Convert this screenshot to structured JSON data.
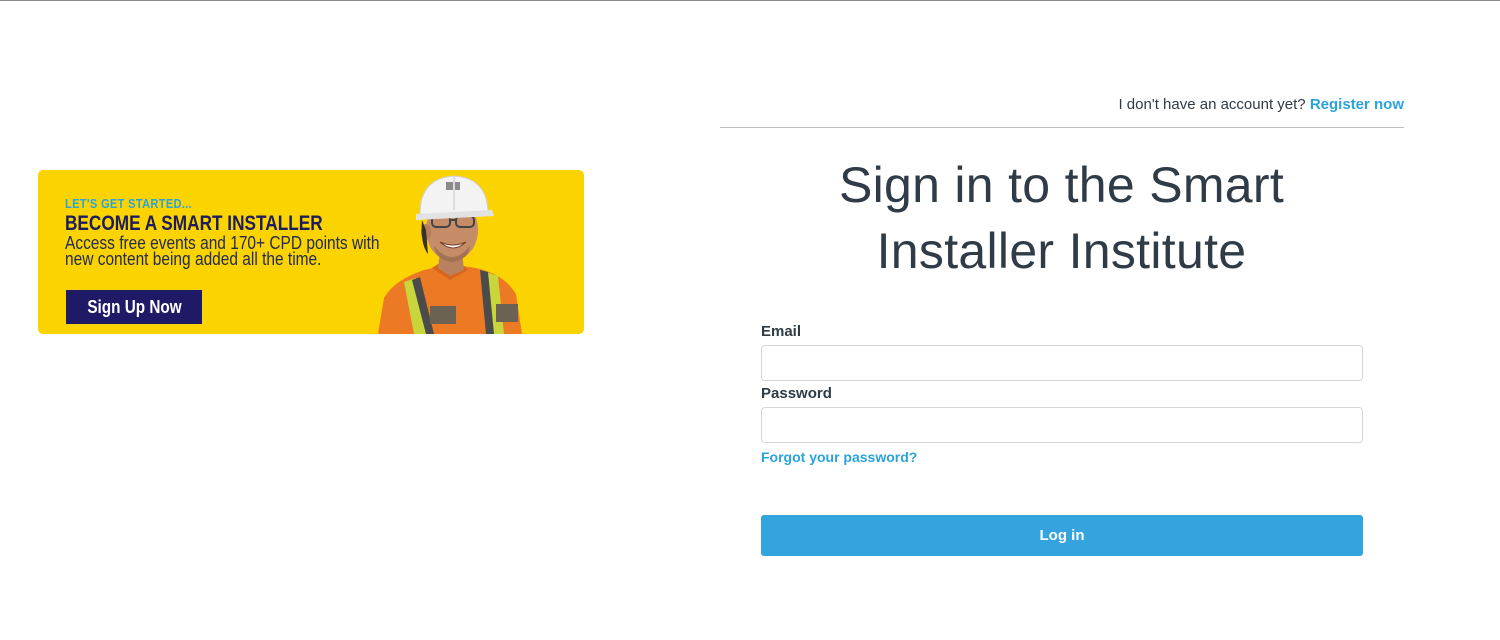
{
  "banner": {
    "eyebrow": "LET'S GET STARTED...",
    "headline": "BECOME A SMART INSTALLER",
    "description": "Access free events and 170+ CPD points with new content being added all the time.",
    "cta_label": "Sign Up Now",
    "background_color": "#fbd400",
    "cta_color": "#1f1a66"
  },
  "auth": {
    "account_prompt": "I don't have an account yet?",
    "register_label": "Register now",
    "title": "Sign in to the Smart Installer Institute",
    "email_label": "Email",
    "email_value": "",
    "password_label": "Password",
    "password_value": "",
    "forgot_label": "Forgot your password?",
    "login_label": "Log in",
    "accent_color": "#34a4de"
  }
}
